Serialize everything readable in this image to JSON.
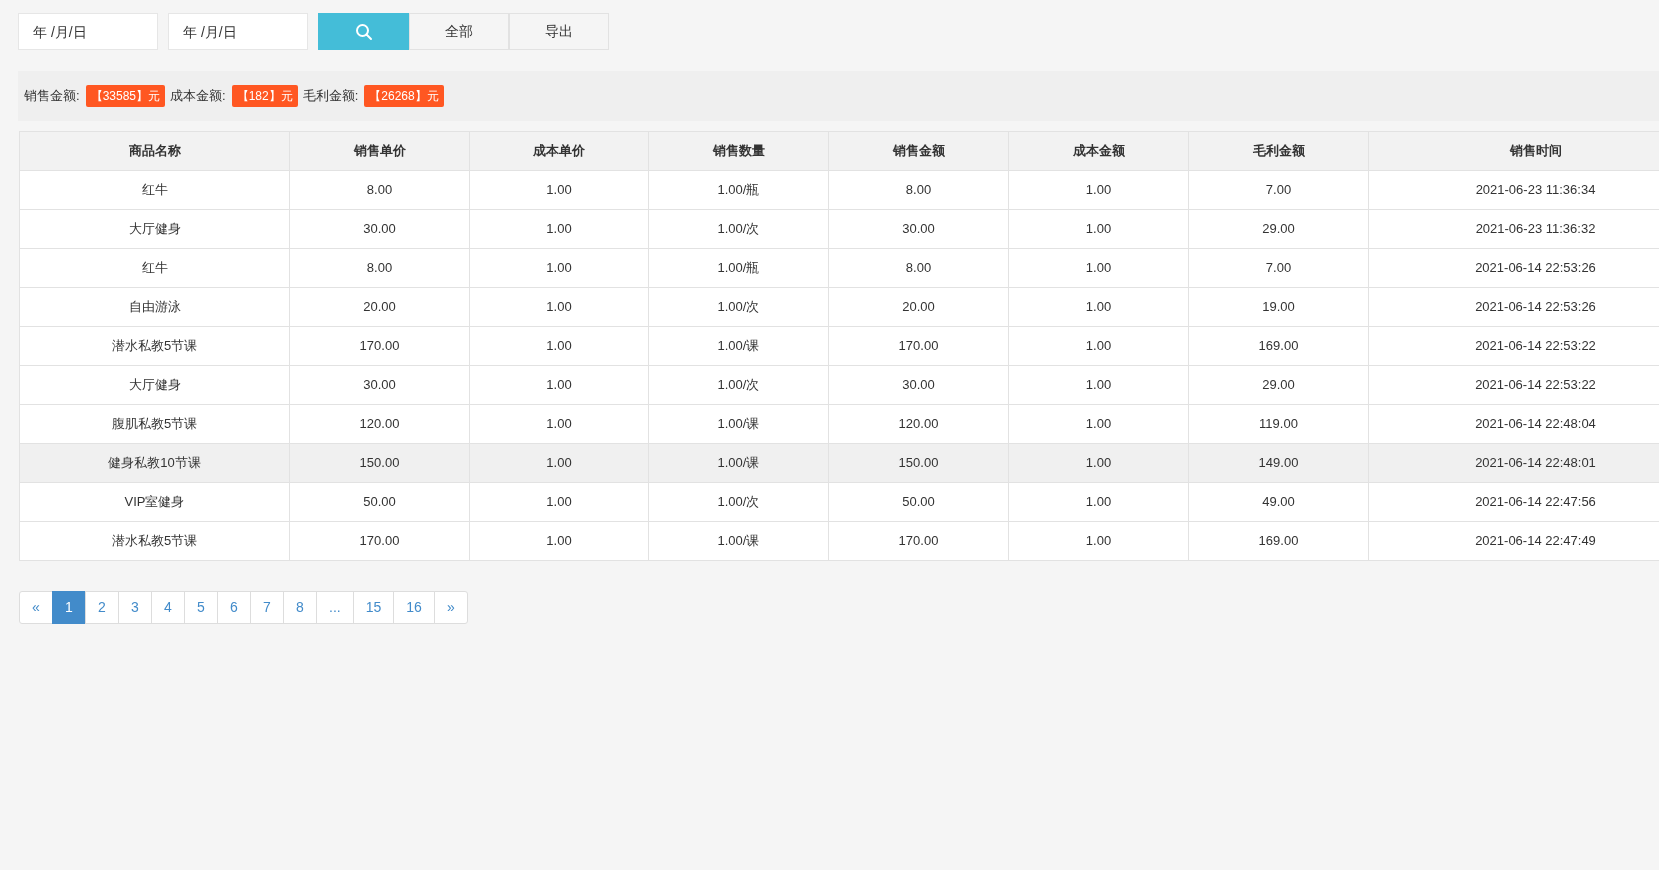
{
  "filters": {
    "date_fields": [
      {
        "placeholder": "年 /月/日"
      },
      {
        "placeholder": "年 /月/日"
      }
    ],
    "buttons": [
      {
        "kind": "search"
      },
      {
        "kind": "text",
        "label": "全部"
      },
      {
        "kind": "text",
        "label": "导出"
      }
    ]
  },
  "summary": [
    {
      "label": "销售金额:",
      "value": "【33585】元"
    },
    {
      "label": "成本金额:",
      "value": "【182】元"
    },
    {
      "label": "毛利金额:",
      "value": "【26268】元"
    }
  ],
  "table": {
    "columns": [
      "商品名称",
      "销售单价",
      "成本单价",
      "销售数量",
      "销售金额",
      "成本金额",
      "毛利金额",
      "销售时间"
    ],
    "rows": [
      {
        "highlighted": false,
        "cells": [
          "红牛",
          "8.00",
          "1.00",
          "1.00/瓶",
          "8.00",
          "1.00",
          "7.00",
          "2021-06-23 11:36:34"
        ]
      },
      {
        "highlighted": false,
        "cells": [
          "大厅健身",
          "30.00",
          "1.00",
          "1.00/次",
          "30.00",
          "1.00",
          "29.00",
          "2021-06-23 11:36:32"
        ]
      },
      {
        "highlighted": false,
        "cells": [
          "红牛",
          "8.00",
          "1.00",
          "1.00/瓶",
          "8.00",
          "1.00",
          "7.00",
          "2021-06-14 22:53:26"
        ]
      },
      {
        "highlighted": false,
        "cells": [
          "自由游泳",
          "20.00",
          "1.00",
          "1.00/次",
          "20.00",
          "1.00",
          "19.00",
          "2021-06-14 22:53:26"
        ]
      },
      {
        "highlighted": false,
        "cells": [
          "潜水私教5节课",
          "170.00",
          "1.00",
          "1.00/课",
          "170.00",
          "1.00",
          "169.00",
          "2021-06-14 22:53:22"
        ]
      },
      {
        "highlighted": false,
        "cells": [
          "大厅健身",
          "30.00",
          "1.00",
          "1.00/次",
          "30.00",
          "1.00",
          "29.00",
          "2021-06-14 22:53:22"
        ]
      },
      {
        "highlighted": false,
        "cells": [
          "腹肌私教5节课",
          "120.00",
          "1.00",
          "1.00/课",
          "120.00",
          "1.00",
          "119.00",
          "2021-06-14 22:48:04"
        ]
      },
      {
        "highlighted": true,
        "cells": [
          "健身私教10节课",
          "150.00",
          "1.00",
          "1.00/课",
          "150.00",
          "1.00",
          "149.00",
          "2021-06-14 22:48:01"
        ]
      },
      {
        "highlighted": false,
        "cells": [
          "VIP室健身",
          "50.00",
          "1.00",
          "1.00/次",
          "50.00",
          "1.00",
          "49.00",
          "2021-06-14 22:47:56"
        ]
      },
      {
        "highlighted": false,
        "cells": [
          "潜水私教5节课",
          "170.00",
          "1.00",
          "1.00/课",
          "170.00",
          "1.00",
          "169.00",
          "2021-06-14 22:47:49"
        ]
      }
    ]
  },
  "pagination": [
    {
      "label": "«",
      "selected": false
    },
    {
      "label": "1",
      "selected": true
    },
    {
      "label": "2",
      "selected": false
    },
    {
      "label": "3",
      "selected": false
    },
    {
      "label": "4",
      "selected": false
    },
    {
      "label": "5",
      "selected": false
    },
    {
      "label": "6",
      "selected": false
    },
    {
      "label": "7",
      "selected": false
    },
    {
      "label": "8",
      "selected": false
    },
    {
      "label": "...",
      "selected": false
    },
    {
      "label": "15",
      "selected": false
    },
    {
      "label": "16",
      "selected": false
    },
    {
      "label": "»",
      "selected": false
    }
  ]
}
